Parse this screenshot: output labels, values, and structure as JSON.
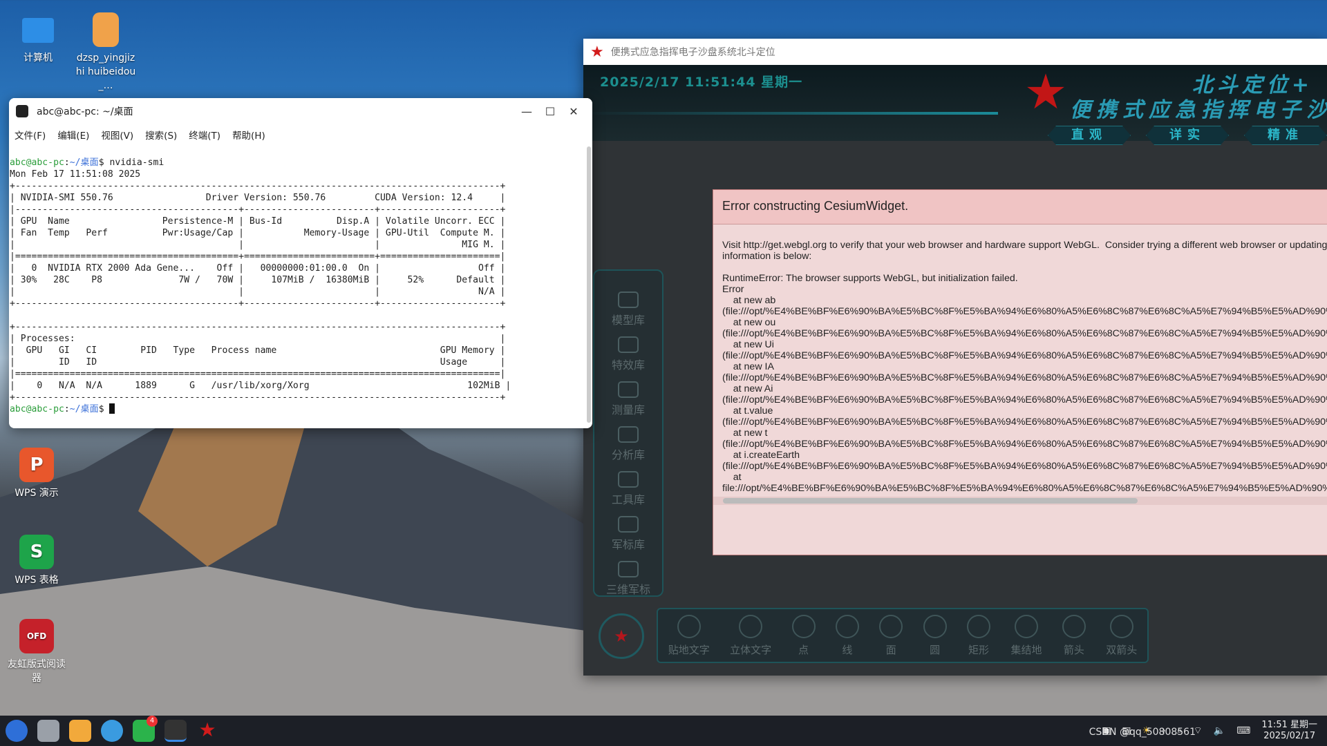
{
  "desktop": {
    "icons": [
      {
        "label": "计算机"
      },
      {
        "label": "dzsp_yingjizhi huibeidou_…"
      },
      {
        "label": "WPS 演示"
      },
      {
        "label": "WPS 表格"
      },
      {
        "label": "友虹版式阅读器"
      }
    ]
  },
  "terminal": {
    "title": "abc@abc-pc: ~/桌面",
    "menu": [
      "文件(F)",
      "编辑(E)",
      "视图(V)",
      "搜索(S)",
      "终端(T)",
      "帮助(H)"
    ],
    "prompt_user": "abc@abc-pc",
    "prompt_dir": "~/桌面",
    "command": "nvidia-smi",
    "output": [
      "Mon Feb 17 11:51:08 2025",
      "+-----------------------------------------------------------------------------------------+",
      "| NVIDIA-SMI 550.76                 Driver Version: 550.76         CUDA Version: 12.4     |",
      "|-----------------------------------------+------------------------+----------------------+",
      "| GPU  Name                 Persistence-M | Bus-Id          Disp.A | Volatile Uncorr. ECC |",
      "| Fan  Temp   Perf          Pwr:Usage/Cap |           Memory-Usage | GPU-Util  Compute M. |",
      "|                                         |                        |               MIG M. |",
      "|=========================================+========================+======================|",
      "|   0  NVIDIA RTX 2000 Ada Gene...    Off |   00000000:01:00.0  On |                  Off |",
      "| 30%   28C    P8              7W /   70W |     107MiB /  16380MiB |     52%      Default |",
      "|                                         |                        |                  N/A |",
      "+-----------------------------------------+------------------------+----------------------+",
      "",
      "+-----------------------------------------------------------------------------------------+",
      "| Processes:                                                                              |",
      "|  GPU   GI   CI        PID   Type   Process name                              GPU Memory |",
      "|        ID   ID                                                               Usage      |",
      "|=========================================================================================|",
      "|    0   N/A  N/A      1889      G   /usr/lib/xorg/Xorg                             102MiB |",
      "+-----------------------------------------------------------------------------------------+"
    ]
  },
  "app": {
    "title": "便携式应急指挥电子沙盘系统北斗定位",
    "datetime": "2025/2/17 11:51:44  星期一",
    "system_name_1": "北斗定位+",
    "system_name_2": "便携式应急指挥电子沙",
    "tabs": [
      "直观",
      "详实",
      "精准"
    ],
    "side_items": [
      "模型库",
      "特效库",
      "测量库",
      "分析库",
      "工具库",
      "军标库",
      "三维军标"
    ],
    "tools": [
      "贴地文字",
      "立体文字",
      "点",
      "线",
      "面",
      "圆",
      "矩形",
      "集结地",
      "箭头",
      "双箭头"
    ],
    "error": {
      "title": "Error constructing CesiumWidget.",
      "body": "Visit http://get.webgl.org to verify that your web browser and hardware support WebGL.  Consider trying a different web browser or updating y\ninformation is below:\n\nRuntimeError: The browser supports WebGL, but initialization failed.\nError\n    at new ab\n(file:///opt/%E4%BE%BF%E6%90%BA%E5%BC%8F%E5%BA%94%E6%80%A5%E6%8C%87%E6%8C%A5%E7%94%B5%E5%AD%90%\n    at new ou\n(file:///opt/%E4%BE%BF%E6%90%BA%E5%BC%8F%E5%BA%94%E6%80%A5%E6%8C%87%E6%8C%A5%E7%94%B5%E5%AD%90%\n    at new Ui\n(file:///opt/%E4%BE%BF%E6%90%BA%E5%BC%8F%E5%BA%94%E6%80%A5%E6%8C%87%E6%8C%A5%E7%94%B5%E5%AD%90%\n    at new IA\n(file:///opt/%E4%BE%BF%E6%90%BA%E5%BC%8F%E5%BA%94%E6%80%A5%E6%8C%87%E6%8C%A5%E7%94%B5%E5%AD%90%\n    at new Ai\n(file:///opt/%E4%BE%BF%E6%90%BA%E5%BC%8F%E5%BA%94%E6%80%A5%E6%8C%87%E6%8C%A5%E7%94%B5%E5%AD%90%\n    at t.value\n(file:///opt/%E4%BE%BF%E6%90%BA%E5%BC%8F%E5%BA%94%E6%80%A5%E6%8C%87%E6%8C%A5%E7%94%B5%E5%AD%90%\n    at new t\n(file:///opt/%E4%BE%BF%E6%90%BA%E5%BC%8F%E5%BA%94%E6%80%A5%E6%8C%87%E6%8C%A5%E7%94%B5%E5%AD%90%\n    at i.createEarth\n(file:///opt/%E4%BE%BF%E6%90%BA%E5%BC%8F%E5%BA%94%E6%80%A5%E6%8C%87%E6%8C%A5%E7%94%B5%E5%AD%90%\n    at\nfile:///opt/%E4%BE%BF%E6%90%BA%E5%BC%8F%E5%BA%94%E6%80%A5%E6%8C%87%E6%8C%A5%E7%94%B5%E5%AD%90%"
    }
  },
  "taskbar": {
    "badge_count": "4",
    "time": "11:51 星期一",
    "date": "2025/02/17",
    "watermark": "CSDN @qq_50808561"
  }
}
